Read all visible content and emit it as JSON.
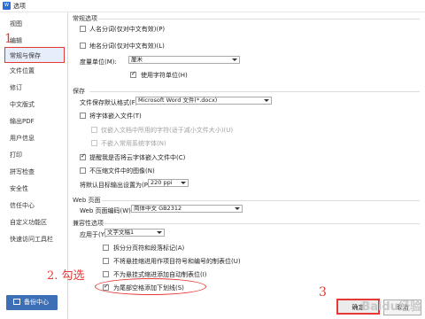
{
  "window": {
    "title": "选项",
    "app_icon": "W"
  },
  "sidebar": {
    "items": [
      {
        "label": "视图"
      },
      {
        "label": "编辑"
      },
      {
        "label": "常规与保存"
      },
      {
        "label": "文件位置"
      },
      {
        "label": "修订"
      },
      {
        "label": "中文版式"
      },
      {
        "label": "输出PDF"
      },
      {
        "label": "用户信息"
      },
      {
        "label": "打印"
      },
      {
        "label": "拼写检查"
      },
      {
        "label": "安全性"
      },
      {
        "label": "信任中心"
      },
      {
        "label": "自定义功能区"
      },
      {
        "label": "快速访问工具栏"
      }
    ],
    "backup_label": "备份中心"
  },
  "general": {
    "title": "常规选项",
    "opt1": "人名分词(仅对中文有效)(P)",
    "opt2": "地名分词(仅对中文有效)(L)",
    "unit_label": "度量单位(M):",
    "unit_value": "厘米",
    "char_unit": "使用字符单位(H)"
  },
  "save": {
    "title": "保存",
    "format_label": "文件保存默认格式(F):",
    "format_value": "Microsoft Word 文件(*.docx)",
    "embed_fonts": "将字体嵌入文件(T)",
    "embed_used": "仅嵌入文档中所用的字符(适于减小文件大小)(U)",
    "no_common": "不嵌入常用系统字体(N)",
    "cloud_remind": "提醒我是否将云字体嵌入文件中(C)",
    "no_compress": "不压缩文件中的图像(N)",
    "ppi_label": "将默认目标输出设置为(P):",
    "ppi_value": "220 ppi"
  },
  "web": {
    "title": "Web 页面",
    "encoding_label": "Web 页面编码(W):",
    "encoding_value": "简体中文 GB2312"
  },
  "compat": {
    "title": "兼容性选项",
    "apply_label": "应用于(Y):",
    "apply_value": "文字文稿1",
    "opt1": "拆分分页符和段落标记(A)",
    "opt2": "不将悬挂缩进用作项目符号和编号的制表位(U)",
    "opt3": "不为悬挂式缩进添加自动制表位(I)",
    "opt4": "为尾部空格添加下划线(S)"
  },
  "buttons": {
    "ok": "确定",
    "cancel": "取消"
  },
  "annotations": {
    "step1": "1",
    "step2": "2. 勾选",
    "step3": "3"
  },
  "watermark": "Baidu经验"
}
